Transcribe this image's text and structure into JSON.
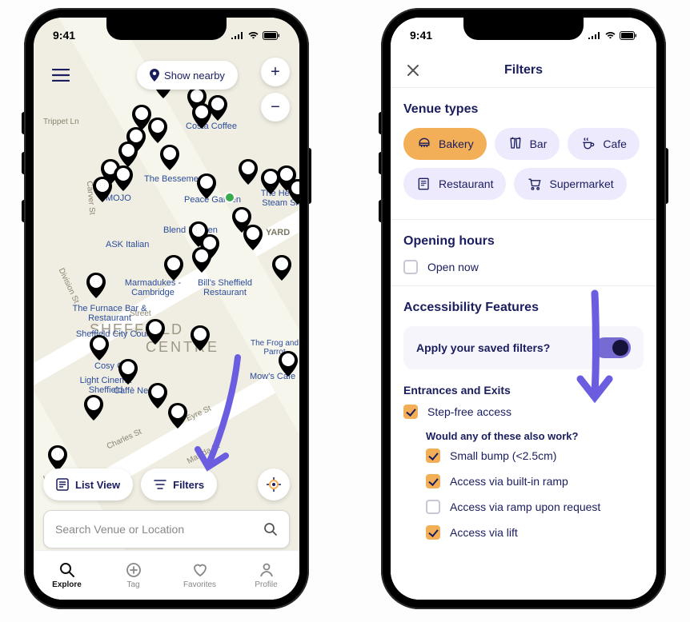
{
  "status": {
    "time": "9:41"
  },
  "phone1": {
    "show_nearby": "Show nearby",
    "list_view": "List View",
    "filters": "Filters",
    "search_placeholder": "Search Venue or Location",
    "tabs": {
      "explore": "Explore",
      "tag": "Tag",
      "favorites": "Favorites",
      "profile": "Profile"
    },
    "street_labels": {
      "trippet": "Trippet Ln",
      "carver": "Carver St",
      "division": "Division St",
      "wellington": "Wellington St",
      "charles": "Charles St",
      "eyre": "Eyre St",
      "matilda": "Matilda St",
      "street": "Street"
    },
    "big_labels": {
      "l1": "SHEFFIELD",
      "l2": "CENTRE"
    },
    "poi": {
      "costa": "Costa Coffee",
      "bessemer": "The Bessemer",
      "mojo": "MOJO",
      "peace_garden": "Peace Garden",
      "head": "The Head of Steam Shef",
      "blend": "Blend Kitchen",
      "yard": "YARD",
      "ask": "ASK Italian",
      "bills": "Bill's Sheffield Restaurant",
      "marmadukes": "Marmadukes - Cambridge",
      "furnace": "The Furnace Bar & Restaurant",
      "sheff_council": "Sheffield City Council",
      "caffe_nero": "Caffè Nero",
      "light": "Light Cinema Sheffield",
      "cosy": "Cosy Club",
      "frog": "The Frog and Parrot",
      "mows": "Mow's Cafe"
    }
  },
  "phone2": {
    "title": "Filters",
    "venue_types_h": "Venue types",
    "chips": {
      "bakery": "Bakery",
      "bar": "Bar",
      "cafe": "Cafe",
      "restaurant": "Restaurant",
      "supermarket": "Supermarket"
    },
    "opening_h": "Opening hours",
    "open_now": "Open now",
    "access_h": "Accessibility Features",
    "apply_saved": "Apply your saved filters?",
    "entrances_h": "Entrances and Exits",
    "step_free": "Step-free access",
    "question": "Would any of these also work?",
    "small_bump": "Small bump (<2.5cm)",
    "builtin_ramp": "Access via built-in ramp",
    "ramp_request": "Access via ramp upon request",
    "via_lift": "Access via lift"
  }
}
